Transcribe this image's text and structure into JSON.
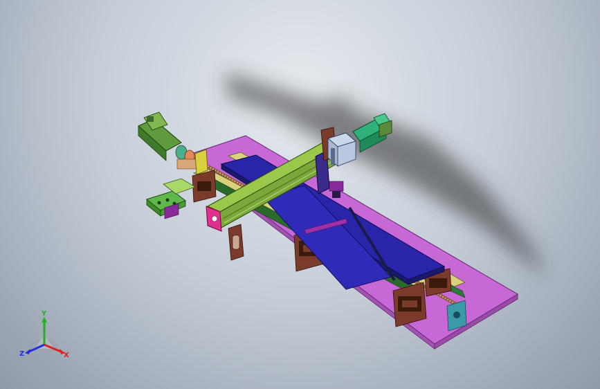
{
  "viewport": {
    "background_top": "#e6eaef",
    "background_bottom": "#8f9aa8"
  },
  "model": {
    "colors": {
      "base_plate": "#c768d6",
      "table": "#2a24a8",
      "gantry_beam": "#7aa83a",
      "end_plate": "#e0308f",
      "motor": "#5f9a3c",
      "motor_right": "#2fb27a",
      "bracket": "#7a3b2a",
      "slider_block": "#3a9aa8",
      "rail": "#d9d27a"
    }
  },
  "triad": {
    "x_label": "X",
    "y_label": "Y",
    "z_label": "Z",
    "x_color": "#e02020",
    "y_color": "#20b020",
    "z_color": "#2030e0"
  }
}
